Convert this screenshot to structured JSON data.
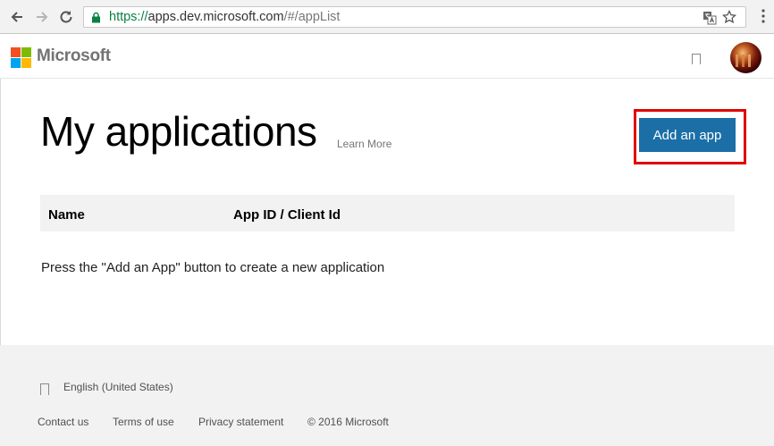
{
  "browser": {
    "url_scheme": "https://",
    "url_host": "apps.dev.microsoft.com",
    "url_path": "/#/appList"
  },
  "header": {
    "brand": "Microsoft",
    "logo_colors": [
      "#f25022",
      "#7fba00",
      "#00a4ef",
      "#ffb900"
    ]
  },
  "main": {
    "title": "My applications",
    "learn_more": "Learn More",
    "add_app_label": "Add an app",
    "columns": [
      "Name",
      "App ID / Client Id"
    ],
    "empty_message": "Press the \"Add an App\" button to create a new application"
  },
  "footer": {
    "locale": "English (United States)",
    "links": [
      "Contact us",
      "Terms of use",
      "Privacy statement"
    ],
    "copyright": "© 2016 Microsoft"
  }
}
